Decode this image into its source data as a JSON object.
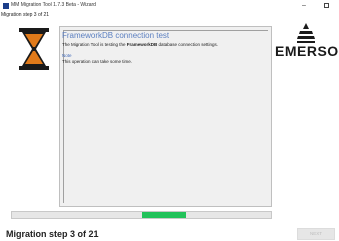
{
  "window": {
    "title": "MM Migration Tool 1.7.3 Beta - Wizard",
    "minimize_glyph": "–",
    "maximize_glyph": "□"
  },
  "wizard": {
    "step_label": "Migration step 3 of 21",
    "icon": "hourglass-icon"
  },
  "content": {
    "heading": "FrameworkDB connection test",
    "description_prefix": "The Migration Tool is testing the ",
    "description_bold": "FrameworkDB",
    "description_suffix": " database connection settings.",
    "note_title": "Note",
    "note_text": "This operation can take some time."
  },
  "branding": {
    "logo_text": "EMERSO",
    "icon": "emerson-logo-mark"
  },
  "progress": {
    "fraction": 0.17,
    "start_fraction": 0.5,
    "color": "#22c25a"
  },
  "footer": {
    "step_text": "Migration step 3 of 21",
    "next_label": "NEXT",
    "next_enabled": false
  },
  "colors": {
    "accent": "#5b7fc0",
    "app_icon": "#1c3e8a",
    "hourglass": "#e07a1a"
  }
}
